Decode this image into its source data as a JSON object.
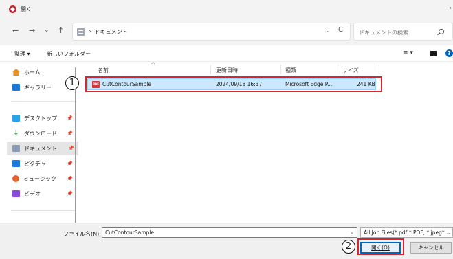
{
  "window": {
    "title": "開く"
  },
  "nav": {
    "back": "←",
    "forward": "→",
    "recent": "⌄",
    "up": "↑",
    "path_items": [
      "ドキュメント"
    ],
    "path_sep": "›",
    "refresh": "C",
    "search_placeholder": "ドキュメントの検索"
  },
  "commandbar": {
    "organize": "整理 ▾",
    "new_folder": "新しいフォルダー",
    "view": "≡ ▾",
    "help": "?"
  },
  "sidebar": {
    "items": [
      {
        "label": "ホーム",
        "icon": "home-icon",
        "color": "#e8912b",
        "pinned": false
      },
      {
        "label": "ギャラリー",
        "icon": "gallery-icon",
        "color": "#1e78d7",
        "pinned": false
      },
      {
        "label": "デスクトップ",
        "icon": "desktop-icon",
        "color": "#2aa3e8",
        "pinned": true
      },
      {
        "label": "ダウンロード",
        "icon": "download-icon",
        "color": "#2a9d4a",
        "pinned": true
      },
      {
        "label": "ドキュメント",
        "icon": "documents-icon",
        "color": "#8a9bb3",
        "pinned": true,
        "selected": true
      },
      {
        "label": "ピクチャ",
        "icon": "pictures-icon",
        "color": "#1e78d7",
        "pinned": true
      },
      {
        "label": "ミュージック",
        "icon": "music-icon",
        "color": "#e3622d",
        "pinned": true
      },
      {
        "label": "ビデオ",
        "icon": "videos-icon",
        "color": "#8a4bd8",
        "pinned": true
      }
    ],
    "pin_glyph": "📌"
  },
  "list": {
    "columns": [
      "名前",
      "更新日時",
      "種類",
      "サイズ"
    ],
    "sort_glyph": "^",
    "rows": [
      {
        "name": "CutContourSample",
        "modified": "2024/09/18 16:37",
        "type": "Microsoft Edge P...",
        "size": "241 KB",
        "icon_text": "PDF",
        "selected": true
      }
    ]
  },
  "footer": {
    "filename_label": "ファイル名(N):",
    "filename_value": "CutContourSample",
    "filetype_value": "All Job Files(*.pdf;*.PDF; *.jpeg* ⌄",
    "open_label": "開く(O)",
    "cancel_label": "キャンセル"
  },
  "annotations": {
    "step1": "1",
    "step2": "2"
  },
  "colors": {
    "accent": "#0067c0",
    "highlight": "#d9262e",
    "selection": "#cce8ff"
  }
}
